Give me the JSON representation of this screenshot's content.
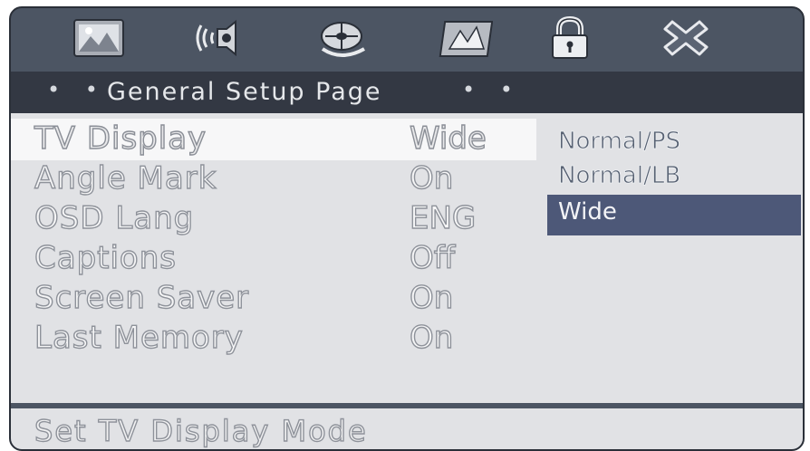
{
  "toolbar": {
    "icons": [
      {
        "name": "picture-icon"
      },
      {
        "name": "audio-speaker-icon"
      },
      {
        "name": "film-reel-icon"
      },
      {
        "name": "video-icon"
      },
      {
        "name": "lock-icon"
      },
      {
        "name": "exit-icon"
      }
    ]
  },
  "title_bar": {
    "dots_left": "• •",
    "title": "General Setup Page",
    "dots_right": "• •"
  },
  "settings": [
    {
      "label": "TV Display",
      "value": "Wide",
      "selected": true
    },
    {
      "label": "Angle Mark",
      "value": "On"
    },
    {
      "label": "OSD Lang",
      "value": "ENG"
    },
    {
      "label": "Captions",
      "value": "Off"
    },
    {
      "label": "Screen Saver",
      "value": "On"
    },
    {
      "label": "Last Memory",
      "value": "On"
    }
  ],
  "options": [
    {
      "label": "Normal/PS"
    },
    {
      "label": "Normal/LB"
    },
    {
      "label": "Wide",
      "highlighted": true
    }
  ],
  "help_bar": {
    "text": "Set TV Display Mode"
  },
  "colors": {
    "frame": "#4c5563",
    "title_bar": "#333843",
    "panel": "#e1e2e5",
    "highlight": "#4d5878"
  }
}
